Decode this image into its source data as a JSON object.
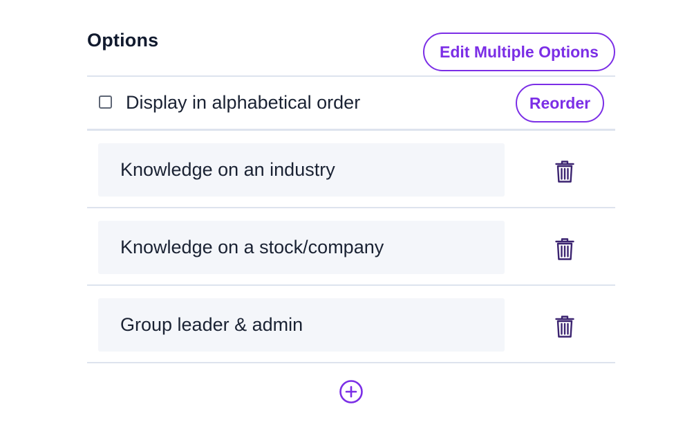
{
  "header": {
    "title": "Options",
    "edit_multiple_label": "Edit Multiple Options"
  },
  "controls": {
    "alphabetical_label": "Display in alphabetical order",
    "alphabetical_checked": false,
    "reorder_label": "Reorder"
  },
  "options": [
    {
      "value": "Knowledge on an industry",
      "delete_icon": "trash-icon"
    },
    {
      "value": "Knowledge on a stock/company",
      "delete_icon": "trash-icon"
    },
    {
      "value": "Group leader & admin",
      "delete_icon": "trash-icon"
    }
  ],
  "add_option": {
    "icon": "plus-circle-icon"
  },
  "colors": {
    "accent": "#7b2ee6",
    "trash": "#3b2370",
    "field_bg": "#f4f6fa",
    "divider": "#dde3ee",
    "text": "#1a2233"
  }
}
